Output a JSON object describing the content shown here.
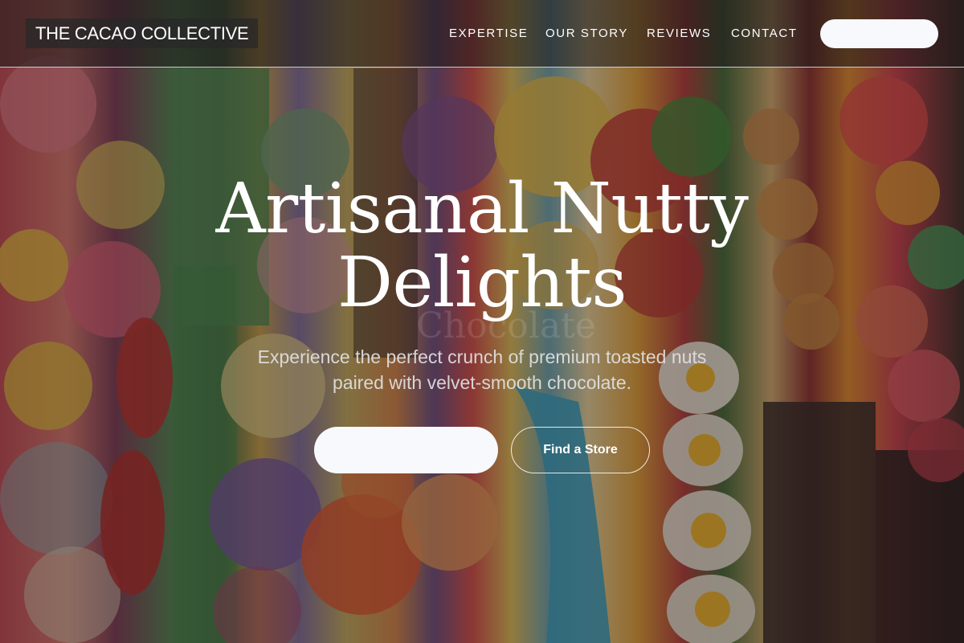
{
  "header": {
    "brand": "THE CACAO COLLECTIVE",
    "nav": [
      {
        "label": "EXPERTISE"
      },
      {
        "label": "OUR STORY"
      },
      {
        "label": "REVIEWS"
      },
      {
        "label": "CONTACT"
      }
    ],
    "cta_label": ""
  },
  "hero": {
    "title_line1": "Artisanal Nutty",
    "title_line2": "Delights",
    "watermark": "Chocolate",
    "subtitle_line1": "Experience the perfect crunch of premium toasted nuts",
    "subtitle_line2": "paired with velvet-smooth chocolate.",
    "primary_button_label": "",
    "secondary_button_label": "Find a Store",
    "background_image": "colorful-candy-assortment"
  },
  "colors": {
    "button_fill": "#f8f9fc",
    "text": "#ffffff",
    "subtitle_text": "#e1e1e1",
    "nav_background": "#1e1a1a",
    "overlay": "#231916"
  }
}
